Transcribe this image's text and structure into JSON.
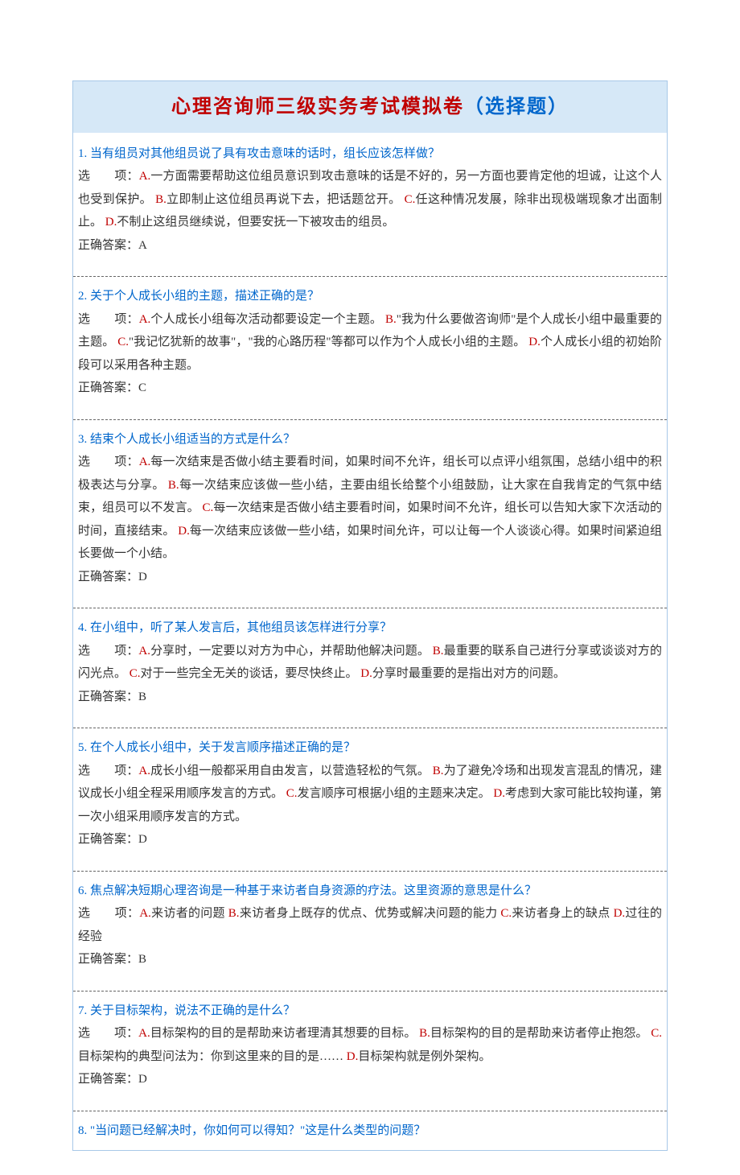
{
  "title_main": "心理咨询师三级实务考试模拟卷",
  "title_sub": "（选择题）",
  "options_prefix": "选　　项：",
  "answer_prefix": "正确答案：",
  "questions": [
    {
      "num": "1.",
      "text": "当有组员对其他组员说了具有攻击意味的话时，组长应该怎样做？",
      "options": [
        {
          "key": "A.",
          "text": "一方面需要帮助这位组员意识到攻击意味的话是不好的，另一方面也要肯定他的坦诚，让这个人也受到保护。"
        },
        {
          "key": "B.",
          "text": "立即制止这位组员再说下去，把话题岔开。"
        },
        {
          "key": "C.",
          "text": "任这种情况发展，除非出现极端现象才出面制止。"
        },
        {
          "key": "D.",
          "text": "不制止这组员继续说，但要安抚一下被攻击的组员。"
        }
      ],
      "answer": "A"
    },
    {
      "num": "2.",
      "text": "关于个人成长小组的主题，描述正确的是？",
      "options": [
        {
          "key": "A.",
          "text": "个人成长小组每次活动都要设定一个主题。"
        },
        {
          "key": "B.",
          "text": "\"我为什么要做咨询师\"是个人成长小组中最重要的主题。"
        },
        {
          "key": "C.",
          "text": "\"我记忆犹新的故事\"，\"我的心路历程\"等都可以作为个人成长小组的主题。"
        },
        {
          "key": "D.",
          "text": "个人成长小组的初始阶段可以采用各种主题。"
        }
      ],
      "answer": "C"
    },
    {
      "num": "3.",
      "text": "结束个人成长小组适当的方式是什么？",
      "options": [
        {
          "key": "A.",
          "text": "每一次结束是否做小结主要看时间，如果时间不允许，组长可以点评小组氛围，总结小组中的积极表达与分享。"
        },
        {
          "key": "B.",
          "text": "每一次结束应该做一些小结，主要由组长给整个小组鼓励，让大家在自我肯定的气氛中结束，组员可以不发言。"
        },
        {
          "key": "C.",
          "text": "每一次结束是否做小结主要看时间，如果时间不允许，组长可以告知大家下次活动的时间，直接结束。"
        },
        {
          "key": "D.",
          "text": "每一次结束应该做一些小结，如果时间允许，可以让每一个人谈谈心得。如果时间紧迫组长要做一个小结。"
        }
      ],
      "answer": "D"
    },
    {
      "num": "4.",
      "text": "在小组中，听了某人发言后，其他组员该怎样进行分享？",
      "options": [
        {
          "key": "A.",
          "text": "分享时，一定要以对方为中心，并帮助他解决问题。"
        },
        {
          "key": "B.",
          "text": "最重要的联系自己进行分享或谈谈对方的闪光点。"
        },
        {
          "key": "C.",
          "text": "对于一些完全无关的谈话，要尽快终止。"
        },
        {
          "key": "D.",
          "text": "分享时最重要的是指出对方的问题。"
        }
      ],
      "answer": "B"
    },
    {
      "num": "5.",
      "text": "在个人成长小组中，关于发言顺序描述正确的是？",
      "options": [
        {
          "key": "A.",
          "text": "成长小组一般都采用自由发言，以营造轻松的气氛。"
        },
        {
          "key": "B.",
          "text": "为了避免冷场和出现发言混乱的情况，建议成长小组全程采用顺序发言的方式。"
        },
        {
          "key": "C.",
          "text": "发言顺序可根据小组的主题来决定。"
        },
        {
          "key": "D.",
          "text": "考虑到大家可能比较拘谨，第一次小组采用顺序发言的方式。"
        }
      ],
      "answer": "D"
    },
    {
      "num": "6.",
      "text": "焦点解决短期心理咨询是一种基于来访者自身资源的疗法。这里资源的意思是什么？",
      "options": [
        {
          "key": "A.",
          "text": "来访者的问题"
        },
        {
          "key": "B.",
          "text": "来访者身上既存的优点、优势或解决问题的能力"
        },
        {
          "key": "C.",
          "text": "来访者身上的缺点"
        },
        {
          "key": "D.",
          "text": "过往的经验"
        }
      ],
      "answer": "B"
    },
    {
      "num": "7.",
      "text": "关于目标架构，说法不正确的是什么？",
      "options": [
        {
          "key": "A.",
          "text": "目标架构的目的是帮助来访者理清其想要的目标。"
        },
        {
          "key": "B.",
          "text": "目标架构的目的是帮助来访者停止抱怨。"
        },
        {
          "key": "C.",
          "text": "目标架构的典型问法为：你到这里来的目的是……"
        },
        {
          "key": "D.",
          "text": "目标架构就是例外架构。"
        }
      ],
      "answer": "D"
    },
    {
      "num": "8.",
      "text": "\"当问题已经解决时，你如何可以得知？\"这是什么类型的问题？",
      "options": [],
      "answer": ""
    }
  ]
}
